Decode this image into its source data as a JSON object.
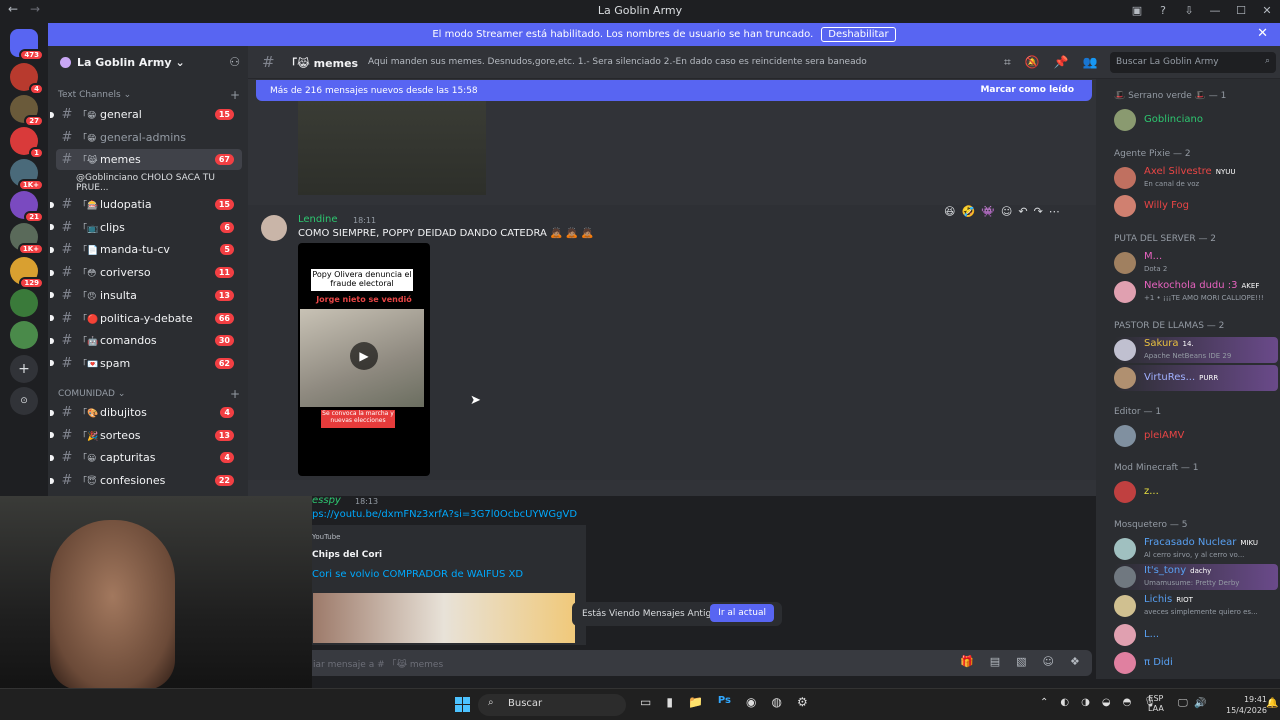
{
  "window": {
    "title": "La Goblin Army",
    "back": "←",
    "forward": "→"
  },
  "banner": {
    "text": "El modo Streamer está habilitado. Los nombres de usuario se han truncado.",
    "button": "Deshabilitar"
  },
  "guilds": [
    {
      "label": "473",
      "color": "#5865f2"
    },
    {
      "label": "4",
      "color": "#b83a2e"
    },
    {
      "label": "27",
      "color": "#6a5a3a"
    },
    {
      "label": "1",
      "color": "#d93a3a"
    },
    {
      "label": "1K+",
      "color": "#4a6a7a"
    },
    {
      "label": "21",
      "color": "#7a4ac0"
    },
    {
      "label": "1K+",
      "color": "#5a6a5a"
    },
    {
      "label": "129",
      "color": "#d9a030"
    },
    {
      "label": "",
      "color": "#3a7a3a"
    },
    {
      "label": "",
      "color": "#4a8a4a"
    }
  ],
  "server": {
    "name": "La Goblin Army"
  },
  "categories": {
    "text": "Text Channels",
    "comunidad": "COMUNIDAD"
  },
  "channels": [
    {
      "name": "general",
      "emoji": "「😁",
      "count": "15",
      "state": "unread"
    },
    {
      "name": "general-admins",
      "emoji": "「😁",
      "count": "",
      "state": "muted"
    },
    {
      "name": "memes",
      "emoji": "「😹",
      "count": "67",
      "state": "active"
    },
    {
      "name": "ludopatia",
      "emoji": "「🎰",
      "count": "15",
      "state": "unread"
    },
    {
      "name": "clips",
      "emoji": "「📺",
      "count": "6",
      "state": "unread"
    },
    {
      "name": "manda-tu-cv",
      "emoji": "「📄",
      "count": "5",
      "state": "unread"
    },
    {
      "name": "coriverso",
      "emoji": "「😳",
      "count": "11",
      "state": "unread"
    },
    {
      "name": "insulta",
      "emoji": "「😠",
      "count": "13",
      "state": "unread"
    },
    {
      "name": "politica-y-debate",
      "emoji": "「🔴",
      "count": "66",
      "state": "unread"
    },
    {
      "name": "comandos",
      "emoji": "「🤖",
      "count": "30",
      "state": "unread"
    },
    {
      "name": "spam",
      "emoji": "「💌",
      "count": "62",
      "state": "unread"
    }
  ],
  "thread": "@Goblinciano CHOLO SACA TU PRUE...",
  "comunidad_channels": [
    {
      "name": "dibujitos",
      "emoji": "「🎨",
      "count": "4"
    },
    {
      "name": "sorteos",
      "emoji": "「🎉",
      "count": "13"
    },
    {
      "name": "capturitas",
      "emoji": "「😀",
      "count": "4"
    },
    {
      "name": "confesiones",
      "emoji": "「😇",
      "count": "22"
    }
  ],
  "header": {
    "channel": "「😹 memes",
    "topic": "Aqui manden sus memes. Desnudos,gore,etc. 1.- Sera silenciado 2.-En dado caso es reincidente sera baneado",
    "search_placeholder": "Buscar La Goblin Army"
  },
  "new_messages": {
    "text": "Más de 216 mensajes nuevos desde las 15:58",
    "action": "Marcar como leído"
  },
  "message1": {
    "author": "Lendine",
    "time": "18:11",
    "text": "COMO SIEMPRE, POPPY DEIDAD DANDO CATEDRA 🙇🏽 🙇🏽 🙇🏽",
    "video_title": "Popy Olivera denuncia el fraude electoral",
    "video_red": "Jorge nieto se vendió",
    "video_sub": "Se convoca la marcha y nuevas elecciones"
  },
  "message2": {
    "author": "esspy",
    "time": "18:13",
    "link": "ps://youtu.be/dxmFNz3xrfA?si=3G7l0OcbcUYWGgVD",
    "provider": "YouTube",
    "embed_author": "Chips del Cori",
    "embed_title": "Cori se volvio COMPRADOR de WAIFUS XD"
  },
  "old_messages": {
    "text": "Estás Viendo Mensajes Antiguos",
    "button": "Ir al actual"
  },
  "input": {
    "placeholder": "iar mensaje a # 「😹 memes"
  },
  "members": {
    "roles": [
      {
        "title": "🎩 Serrano verde 🎩 — 1"
      },
      {
        "title": "Agente Pixie — 2"
      },
      {
        "title": "PUTA DEL SERVER — 2"
      },
      {
        "title": "PASTOR DE LLAMAS — 2"
      },
      {
        "title": "Editor — 1"
      },
      {
        "title": "Mod Minecraft — 1"
      },
      {
        "title": "Mosquetero — 5"
      }
    ],
    "list": [
      {
        "name": "Goblinciano",
        "status": "",
        "tag": "",
        "color": "#2dc770"
      },
      {
        "name": "Axel Silvestre",
        "status": "En canal de voz",
        "tag": "NYUU",
        "color": "#e84545"
      },
      {
        "name": "Willy Fog",
        "status": "",
        "tag": "",
        "color": "#e84545"
      },
      {
        "name": "M...",
        "status": "Dota 2",
        "tag": "",
        "color": "#e863c0"
      },
      {
        "name": "Nekochola dudu :3",
        "status": "+1 • ¡¡¡TE AMO MORI CALLIOPE!!!",
        "tag": "AKEF",
        "color": "#e863c0"
      },
      {
        "name": "Sakura",
        "status": "Apache NetBeans IDE 29",
        "tag": "14.",
        "color": "#e8c040"
      },
      {
        "name": "VirtuRes...",
        "status": "",
        "tag": "PURR",
        "color": "#a0b0ff"
      },
      {
        "name": "pleiAMV",
        "status": "",
        "tag": "",
        "color": "#e84545"
      },
      {
        "name": "z...",
        "status": "",
        "tag": "",
        "color": "#e8e040"
      },
      {
        "name": "Fracasado Nuclear",
        "status": "Al cerro sirvo, y al cerro vo...",
        "tag": "MIKU",
        "color": "#58a0f2"
      },
      {
        "name": "It's_tony",
        "status": "Umamusume: Pretty Derby",
        "tag": "dachy",
        "color": "#58a0f2"
      },
      {
        "name": "Lichis",
        "status": "aveces simplemente quiero es...",
        "tag": "RIOT",
        "color": "#58a0f2"
      },
      {
        "name": "L...",
        "status": "",
        "tag": "",
        "color": "#58a0f2"
      },
      {
        "name": "π Didi",
        "status": "",
        "tag": "",
        "color": "#58a0f2"
      }
    ]
  },
  "taskbar": {
    "search": "Buscar",
    "lang1": "ESP",
    "lang2": "LAA",
    "time": "19:41",
    "date": "15/4/2026"
  }
}
